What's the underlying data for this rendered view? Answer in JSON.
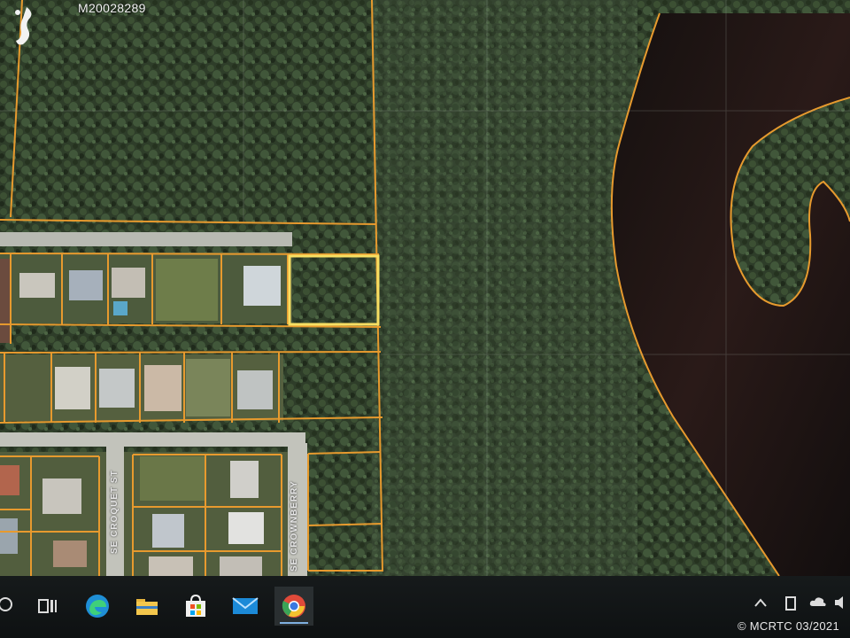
{
  "listing_id": "M20028289",
  "copyright": "© MCRTC 03/2021",
  "streets": [
    {
      "name": "SE CROQUET ST"
    },
    {
      "name": "SE CROWNBERRY"
    }
  ],
  "colors": {
    "parcel_lines": "#e79a2e",
    "selected_parcel": "#f7df63",
    "forest": "#2f3f2a",
    "water": "#1b1513",
    "road": "#b8bab2"
  },
  "taskbar": {
    "icons": [
      "search-icon",
      "task-view-icon",
      "edge-browser-icon",
      "file-explorer-icon",
      "store-icon",
      "mail-icon",
      "chrome-icon"
    ],
    "active_icon": "chrome-icon",
    "tray_icons": [
      "chevron-up-icon",
      "battery-icon",
      "cloud-icon",
      "speaker-icon"
    ]
  }
}
